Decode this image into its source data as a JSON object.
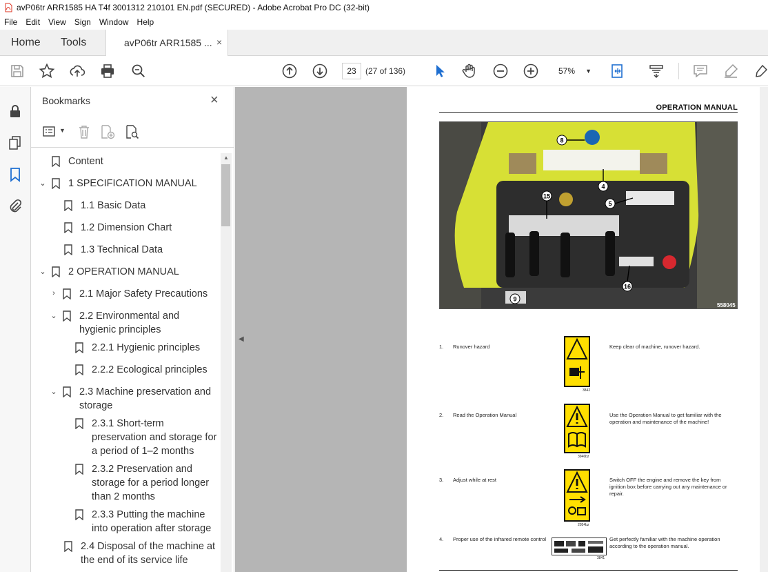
{
  "window": {
    "title": "avP06tr ARR1585 HA T4f 3001312 210101 EN.pdf (SECURED) - Adobe Acrobat Pro DC (32-bit)"
  },
  "menu": [
    "File",
    "Edit",
    "View",
    "Sign",
    "Window",
    "Help"
  ],
  "tabs": {
    "home": "Home",
    "tools": "Tools",
    "document": "avP06tr ARR1585 ...",
    "close": "×"
  },
  "toolbar": {
    "page_number": "23",
    "page_count": "(27 of 136)",
    "zoom": "57%"
  },
  "bookmarks": {
    "header": "Bookmarks",
    "close": "×",
    "items": [
      {
        "label": "Content"
      },
      {
        "label": "1 SPECIFICATION MANUAL"
      },
      {
        "label": "1.1 Basic Data"
      },
      {
        "label": "1.2 Dimension Chart"
      },
      {
        "label": "1.3 Technical Data"
      },
      {
        "label": "2 OPERATION MANUAL"
      },
      {
        "label": "2.1 Major Safety Precautions"
      },
      {
        "label": "2.2 Environmental and hygienic principles"
      },
      {
        "label": "2.2.1 Hygienic principles"
      },
      {
        "label": "2.2.2 Ecological principles"
      },
      {
        "label": "2.3 Machine preservation and storage"
      },
      {
        "label": "2.3.1 Short-term preservation and storage for a period of 1–2 months"
      },
      {
        "label": "2.3.2 Preservation and storage for a period longer than 2 months"
      },
      {
        "label": "2.3.3 Putting the machine into operation after storage"
      },
      {
        "label": "2.4 Disposal of the machine at the end of its service life"
      }
    ]
  },
  "page": {
    "heading": "OPERATION MANUAL",
    "photo_code": "558045",
    "callouts": [
      "8",
      "4",
      "15",
      "5",
      "16",
      "9"
    ],
    "rows": [
      {
        "num": "1.",
        "name": "Runover hazard",
        "desc": "Keep clear of machine, runover hazard.",
        "code": "3842"
      },
      {
        "num": "2.",
        "name": "Read the Operation Manual",
        "desc": "Use the Operation Manual to get familiar with the operation and maintenance of the machine!",
        "code": "3946bz"
      },
      {
        "num": "3.",
        "name": "Adjust while at rest",
        "desc": "Switch OFF the engine and remove the key from ignition box before carrying out any maintenance or repair.",
        "code": "2054bz"
      },
      {
        "num": "4.",
        "name": "Proper use of the infrared remote control",
        "desc": "Get perfectly familiar with the machine operation according to the operation manual.",
        "code": "3841"
      }
    ]
  }
}
